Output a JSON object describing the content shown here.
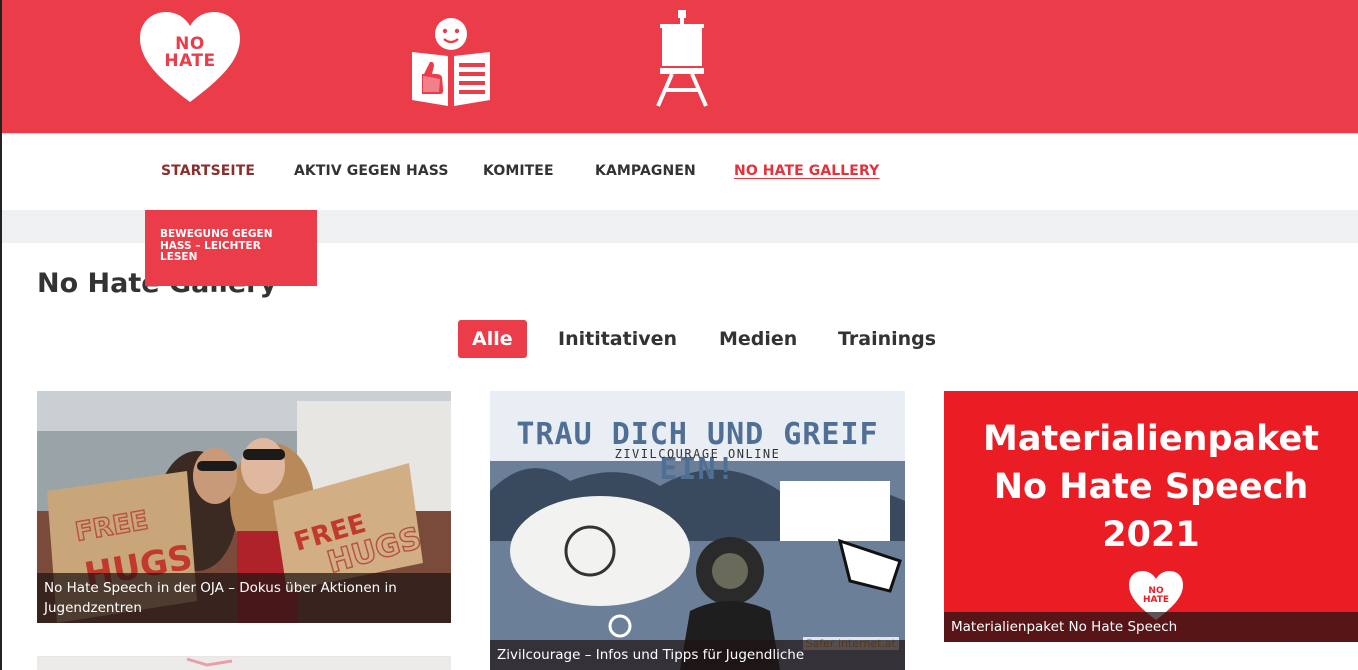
{
  "header": {
    "logo_text": "NO\nHATE",
    "icons": [
      "reader-thumbs-up-icon",
      "easel-icon"
    ]
  },
  "nav": {
    "items": [
      {
        "label": "STARTSEITE"
      },
      {
        "label": "AKTIV GEGEN HASS"
      },
      {
        "label": "KOMITEE"
      },
      {
        "label": "KAMPAGNEN"
      },
      {
        "label": "NO HATE GALLERY"
      }
    ],
    "active": "NO HATE GALLERY"
  },
  "dropdown": {
    "lines": [
      "BEWEGUNG GEGEN",
      "HASS – LEICHTER",
      "LESEN"
    ]
  },
  "page": {
    "title": "No Hate Gallery"
  },
  "filters": [
    {
      "label": "Alle",
      "selected": true
    },
    {
      "label": "Inititativen",
      "selected": false
    },
    {
      "label": "Medien",
      "selected": false
    },
    {
      "label": "Trainings",
      "selected": false
    }
  ],
  "cards": [
    {
      "caption": "No Hate Speech in der OJA – Dokus über Aktionen in Jugendzentren",
      "sign_left": "FREE\nHUGS",
      "sign_right": "FREE\nHUGS"
    },
    {
      "caption": "Zivilcourage – Infos und Tipps für Jugendliche",
      "image_title": "TRAU DICH UND GREIF EIN!",
      "image_subtitle": "ZIVILCOURAGE ONLINE",
      "image_brand": "Safer internet.at"
    },
    {
      "caption": "Materialienpaket No Hate Speech",
      "image_title": "Materialienpaket\nNo Hate Speech\n2021",
      "heart_text": "NO\nHATE"
    }
  ],
  "colors": {
    "brand": "#ea3c49",
    "nav_text": "#333333",
    "startseite": "#8b2e2e"
  }
}
